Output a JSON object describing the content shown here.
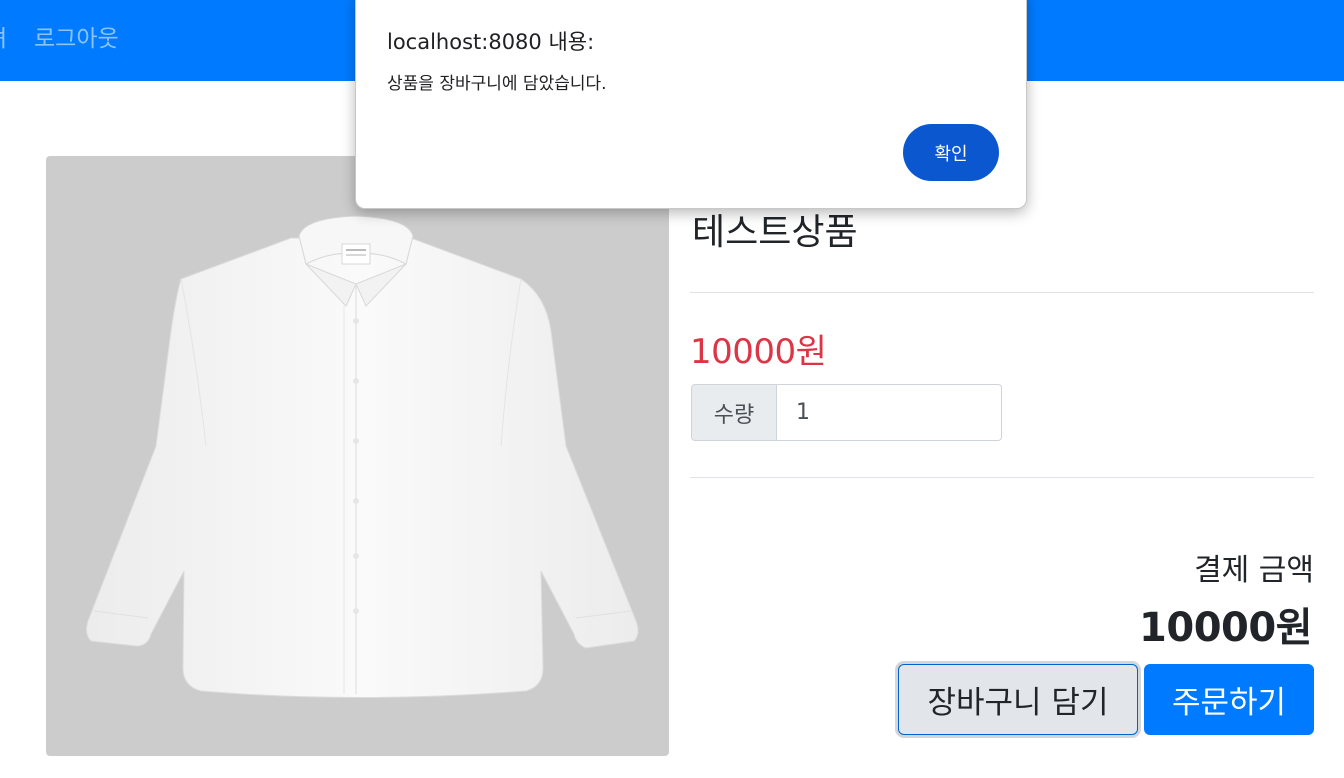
{
  "navbar": {
    "cut_item_label": "녀",
    "logout_label": "로그아웃",
    "background_color": "#007bff"
  },
  "product": {
    "name": "테스트상품",
    "price": "10000원",
    "quantity_label": "수량",
    "quantity_value": "1",
    "image_icon": "white-shirt-image"
  },
  "order": {
    "total_label": "결제 금액",
    "total_value": "10000원",
    "add_to_cart_label": "장바구니 담기",
    "order_label": "주문하기"
  },
  "alert": {
    "title": "localhost:8080 내용:",
    "message": "상품을 장바구니에 담았습니다.",
    "ok_label": "확인",
    "ok_color": "#0b57d0"
  },
  "colors": {
    "price": "#dc3545",
    "primary": "#007bff"
  }
}
